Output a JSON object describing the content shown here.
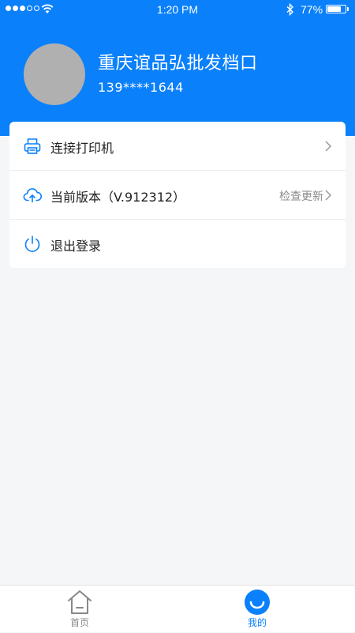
{
  "status_bar": {
    "time": "1:20 PM",
    "battery_percent": "77%",
    "battery_level": 0.77,
    "signal_bars": 3,
    "signal_total": 5
  },
  "profile": {
    "shop_name": "重庆谊品弘批发档口",
    "phone": "139****1644"
  },
  "menu": {
    "items": [
      {
        "label": "连接打印机",
        "icon": "printer-icon"
      },
      {
        "label": "当前版本（V.912312）",
        "icon": "cloud-upload-icon",
        "right_text": "检查更新"
      },
      {
        "label": "退出登录",
        "icon": "power-icon"
      }
    ]
  },
  "tab_bar": {
    "tabs": [
      {
        "label": "首页",
        "icon": "home-icon",
        "active": false
      },
      {
        "label": "我的",
        "icon": "smile-icon",
        "active": true
      }
    ]
  },
  "colors": {
    "accent": "#0a80fb",
    "background": "#f5f6f8",
    "avatar": "#b0b0b0"
  }
}
